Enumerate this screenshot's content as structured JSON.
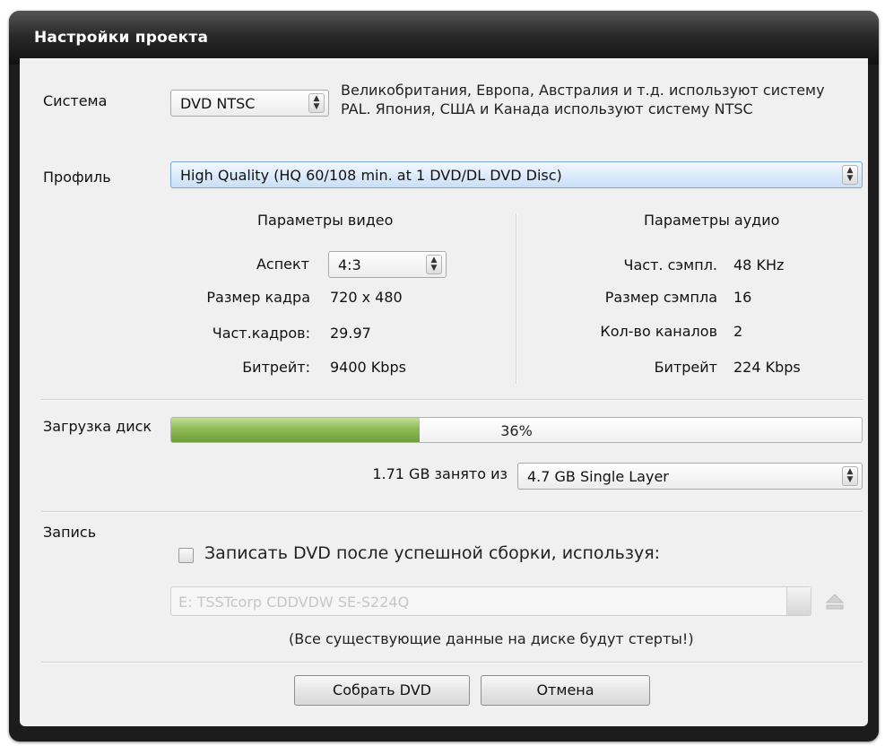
{
  "window": {
    "title": "Настройки проекта"
  },
  "system": {
    "label": "Система",
    "value": "DVD NTSC",
    "description": "Великобритания, Европа, Австралия и т.д. используют систему PAL. Япония, США и Канада используют систему NTSC"
  },
  "profile": {
    "label": "Профиль",
    "value": "High Quality (HQ 60/108 min. at 1 DVD/DL DVD Disc)"
  },
  "video": {
    "heading": "Параметры видео",
    "aspect_label": "Аспект",
    "aspect_value": "4:3",
    "frame_size_label": "Размер кадра",
    "frame_size_value": "720 x 480",
    "frame_rate_label": "Част.кадров:",
    "frame_rate_value": "29.97",
    "bitrate_label": "Битрейт:",
    "bitrate_value": "9400 Kbps"
  },
  "audio": {
    "heading": "Параметры аудио",
    "sample_rate_label": "Част. сэмпл.",
    "sample_rate_value": "48 KHz",
    "sample_size_label": "Размер сэмпла",
    "sample_size_value": "16",
    "channels_label": "Кол-во каналов",
    "channels_value": "2",
    "bitrate_label": "Битрейт",
    "bitrate_value": "224 Kbps"
  },
  "disk": {
    "label": "Загрузка диск",
    "progress_fraction": 0.36,
    "percent_text": "36%",
    "used_text": "1.71 GB занято из",
    "disc_type": "4.7 GB Single Layer"
  },
  "burn": {
    "label": "Запись",
    "checkbox_label": "Записать DVD после успешной сборки, используя:",
    "checked": false,
    "drive_value": "E: TSSTcorp CDDVDW SE-S224Q",
    "warning": "(Все существующие данные на диске будут стерты!)"
  },
  "buttons": {
    "build": "Собрать DVD",
    "cancel": "Отмена"
  },
  "colors": {
    "titlebar": "#1c1c1c",
    "client_bg": "#f0f0f0",
    "progress_green": "#8fbc55",
    "profile_select": "#c9dff6"
  },
  "icons": {
    "spinner": "spinner-arrows-icon",
    "eject": "eject-icon"
  }
}
